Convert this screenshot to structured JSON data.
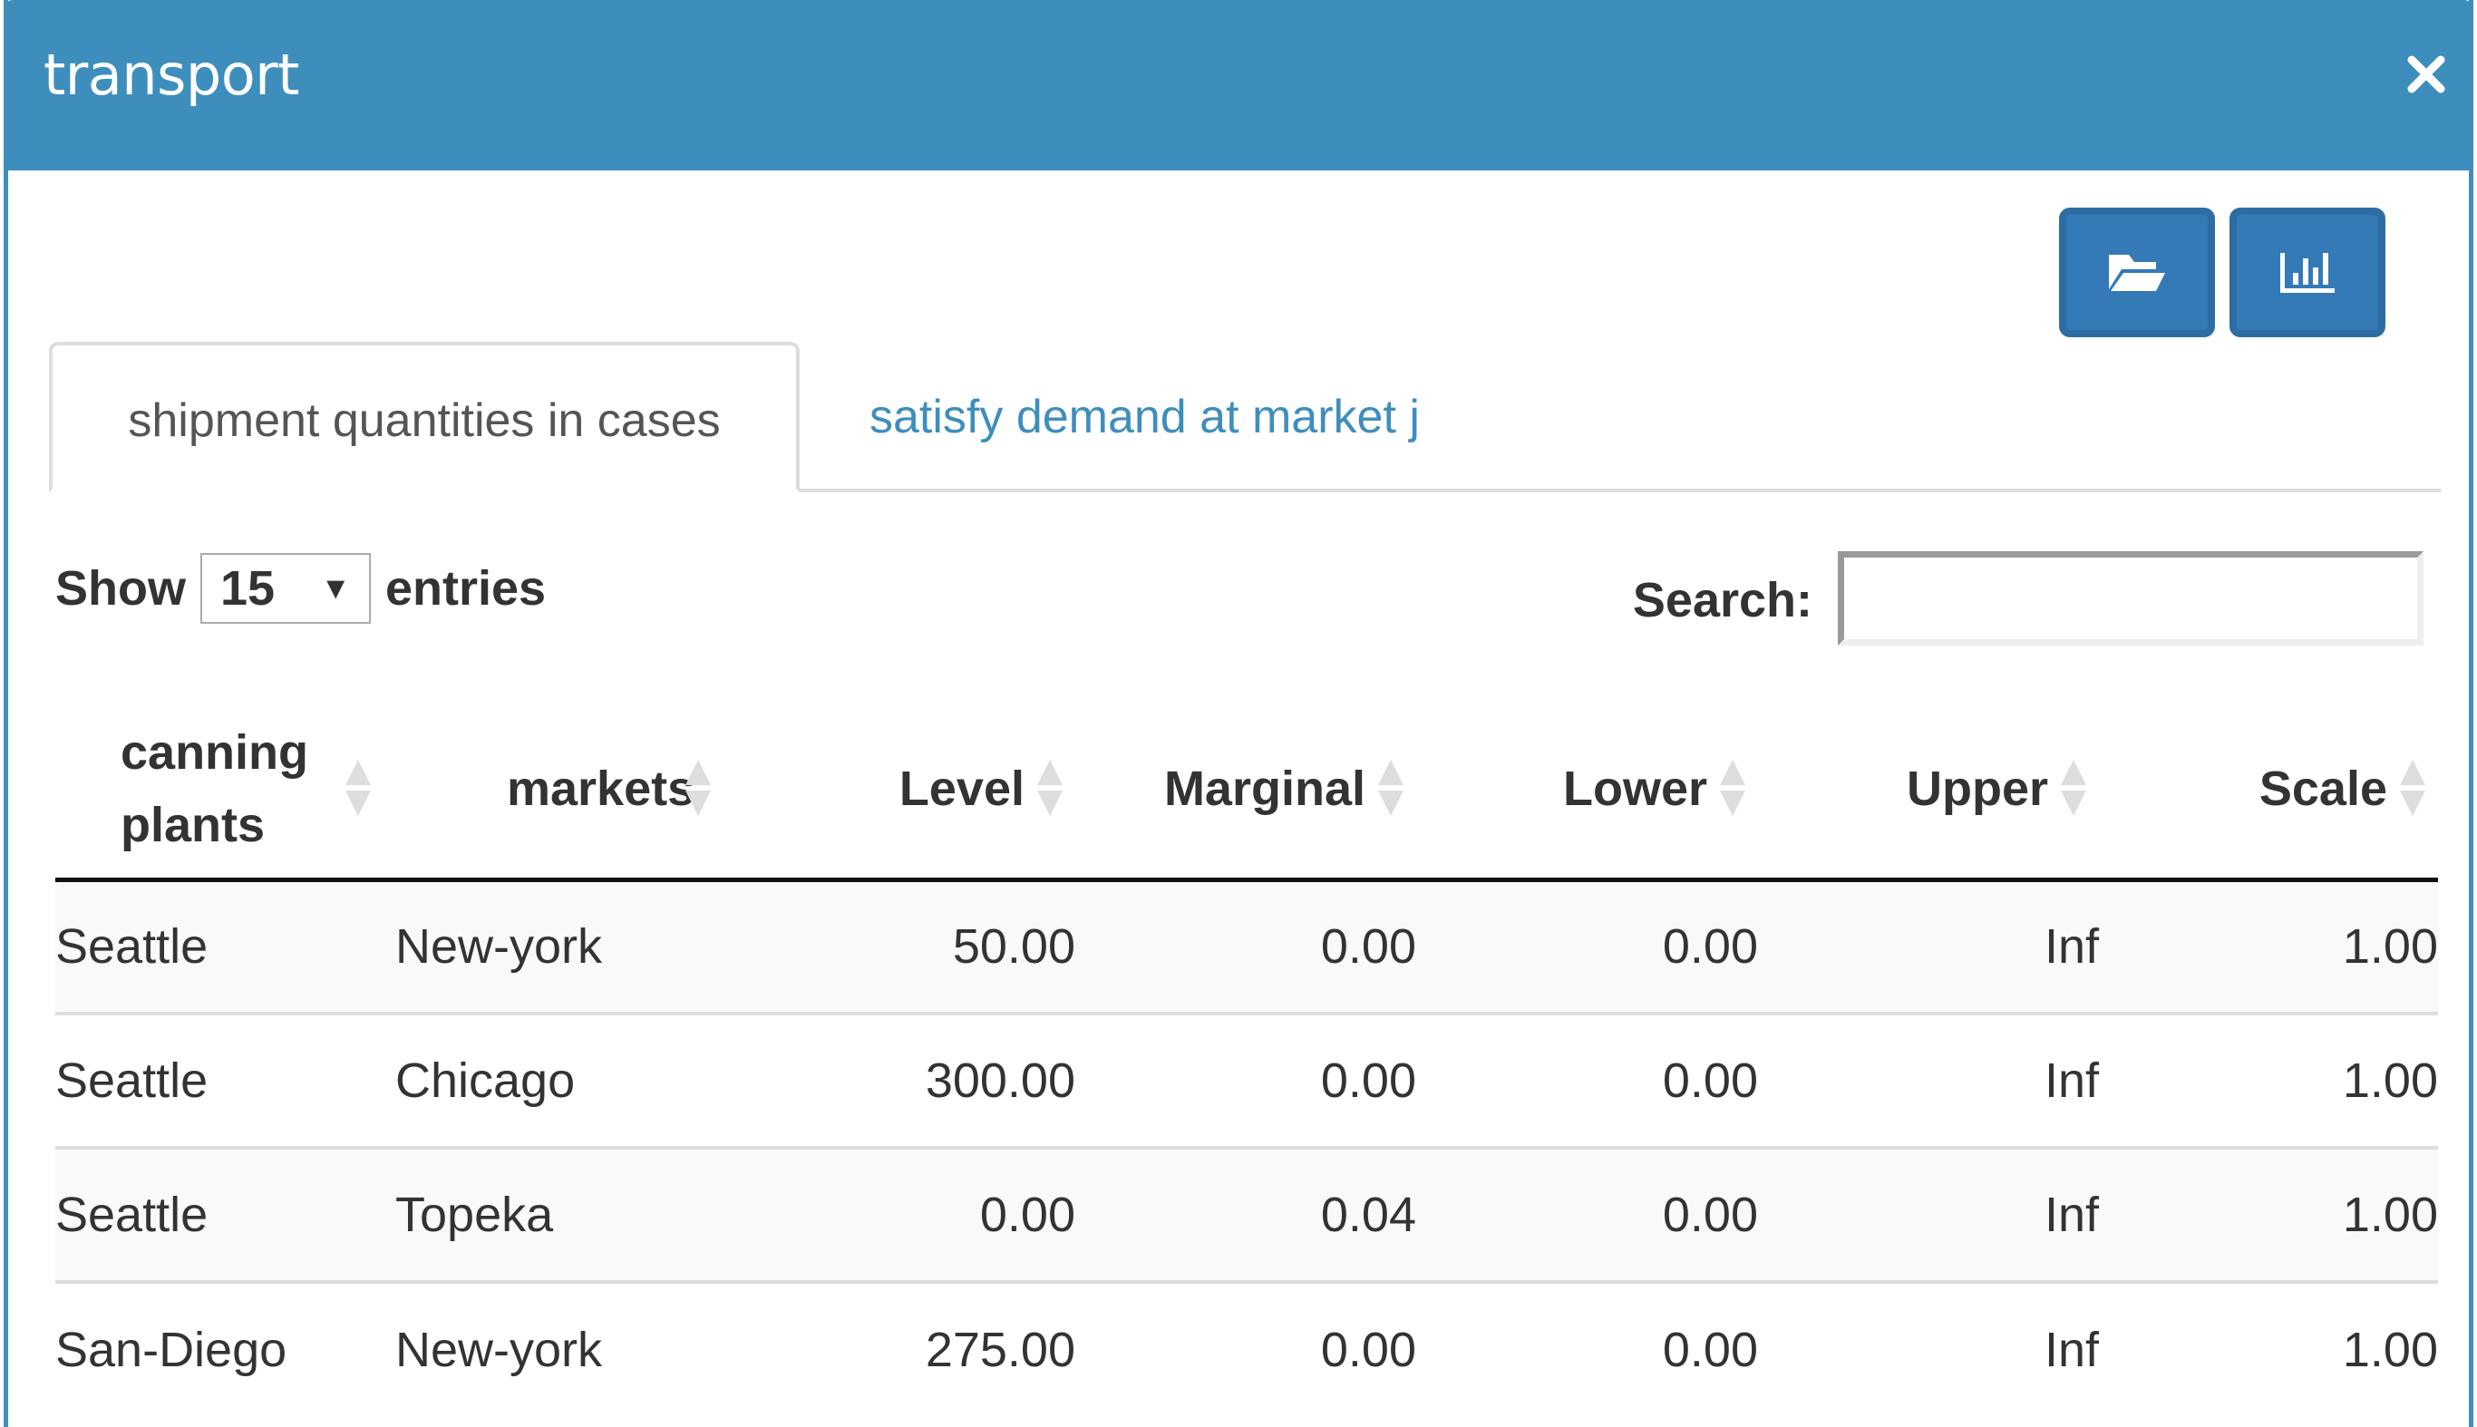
{
  "window": {
    "title": "transport",
    "close_icon": "close-icon"
  },
  "toolbar": {
    "buttons": [
      {
        "name": "open-folder-button",
        "icon": "folder-open-icon"
      },
      {
        "name": "chart-button",
        "icon": "bar-chart-icon"
      }
    ]
  },
  "tabs": [
    {
      "label": "shipment quantities in cases",
      "active": true
    },
    {
      "label": "satisfy demand at market j",
      "active": false
    }
  ],
  "table_controls": {
    "show_label": "Show",
    "entries_value": "15",
    "entries_label": "entries",
    "search_label": "Search:",
    "search_value": "",
    "search_placeholder": ""
  },
  "table": {
    "columns": [
      {
        "label": "canning plants",
        "align": "left"
      },
      {
        "label": "markets",
        "align": "left"
      },
      {
        "label": "Level",
        "align": "right"
      },
      {
        "label": "Marginal",
        "align": "right"
      },
      {
        "label": "Lower",
        "align": "right"
      },
      {
        "label": "Upper",
        "align": "right"
      },
      {
        "label": "Scale",
        "align": "right"
      }
    ],
    "rows": [
      [
        "Seattle",
        "New-york",
        "50.00",
        "0.00",
        "0.00",
        "Inf",
        "1.00"
      ],
      [
        "Seattle",
        "Chicago",
        "300.00",
        "0.00",
        "0.00",
        "Inf",
        "1.00"
      ],
      [
        "Seattle",
        "Topeka",
        "0.00",
        "0.04",
        "0.00",
        "Inf",
        "1.00"
      ],
      [
        "San-Diego",
        "New-york",
        "275.00",
        "0.00",
        "0.00",
        "Inf",
        "1.00"
      ]
    ]
  },
  "colors": {
    "header_bg": "#3e8ebd",
    "button_bg": "#337ab7",
    "button_border": "#2e6da4",
    "tab_link": "#3e8ebd",
    "text": "#333333",
    "row_stripe": "#f9f9f9"
  }
}
